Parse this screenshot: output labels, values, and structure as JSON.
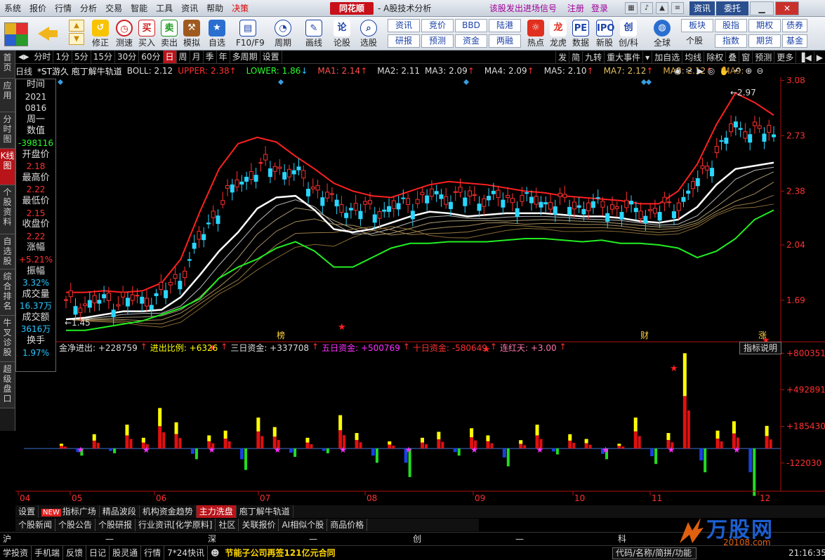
{
  "menubar": {
    "items": [
      "系统",
      "报价",
      "行情",
      "分析",
      "交易",
      "智能",
      "工具",
      "资讯",
      "帮助",
      "决策"
    ],
    "brand": "同花顺",
    "subtitle": "- A股技术分析",
    "promo": "该股发出进场信号",
    "register": "注册",
    "login": "登录",
    "news_btn": "资讯",
    "trade_btn": "委托"
  },
  "toolbar": {
    "buttons": [
      "修正",
      "测速",
      "买入",
      "卖出",
      "模拟",
      "自选",
      "F10/F9",
      "周期",
      "画线",
      "论股",
      "选股",
      "热点",
      "龙虎",
      "数据",
      "新股",
      "创/科",
      "全球",
      "个股"
    ],
    "grid": [
      [
        "资讯",
        "竞价",
        "BBD",
        "陆港"
      ],
      [
        "研报",
        "预测",
        "资金",
        "两融"
      ],
      [
        "板块",
        "股指",
        "期权",
        "债券"
      ],
      [
        "指数",
        "期货",
        "基金"
      ]
    ]
  },
  "leftnav": [
    "首页",
    "应用",
    "分时图",
    "K线图",
    "个股资料",
    "自选股",
    "综合排名",
    "牛叉诊股",
    "超级盘口"
  ],
  "periodbar": {
    "tabs": [
      "分时",
      "1分",
      "5分",
      "15分",
      "30分",
      "60分",
      "日",
      "周",
      "月",
      "季",
      "年",
      "多周期",
      "设置"
    ],
    "active": "日",
    "right": [
      "发",
      "简",
      "九转",
      "重大事件",
      "加自选",
      "均线",
      "除权",
      "叠",
      "窗",
      "预测",
      "更多"
    ]
  },
  "chartheader": {
    "period": "日线",
    "name": "*ST游久  庖丁解牛轨道",
    "boll": "BOLL: 2.12",
    "upper": "UPPER: 2.38",
    "lower": "LOWER: 1.86",
    "ma1": "MA1: 2.14",
    "ma2": "MA2: 2.11",
    "ma3": "MA3: 2.09",
    "ma4": "MA4: 2.09",
    "ma5": "MA5: 2.10",
    "ma7": "MA7: 2.12",
    "ma8": "MA8: 2.12",
    "ma9": "MA9:"
  },
  "datawin": {
    "time_label": "时间",
    "year": "2021",
    "date": "0816",
    "weekday": "周一",
    "value_label": "数值",
    "value": "-398116",
    "open_label": "开盘价",
    "open": "2.18",
    "high_label": "最高价",
    "high": "2.22",
    "low_label": "最低价",
    "low": "2.15",
    "close_label": "收盘价",
    "close": "2.22",
    "chg_label": "涨幅",
    "chg": "+5.21%",
    "amp_label": "振幅",
    "amp": "3.32%",
    "vol_label": "成交量",
    "vol": "16.37万",
    "amt_label": "成交额",
    "amt": "3616万",
    "turn_label": "换手",
    "turn": "1.97%"
  },
  "flowheader": {
    "net": "金净进出: +228759",
    "ratio": "进出比例: +6326",
    "three": "三日资金: +337708",
    "five": "五日资金: +500769",
    "ten": "十日资金: -580649",
    "streak": "连红天: +3.00",
    "explain_btn": "指标说明"
  },
  "chart_data": [
    {
      "type": "candlestick",
      "title": "",
      "y_ticks": [
        "3.08",
        "2.73",
        "2.38",
        "2.04",
        "1.69"
      ],
      "ylim": [
        1.45,
        3.1
      ],
      "x_ticks": [
        "04",
        "05",
        "06",
        "07",
        "08",
        "09",
        "10",
        "11",
        "12"
      ],
      "annotations": {
        "high_label": "2.97",
        "low_label": "1.45",
        "event_labels": [
          "榜",
          "财",
          "涨"
        ]
      },
      "grid": false,
      "series": [
        {
          "name": "UPPER",
          "color": "#ff2020",
          "values": [
            1.74,
            1.74,
            1.75,
            1.74,
            1.75,
            1.8,
            1.95,
            2.25,
            2.52,
            2.68,
            2.72,
            2.69,
            2.6,
            2.52,
            2.43,
            2.38,
            2.35,
            2.34,
            2.38,
            2.42,
            2.44,
            2.43,
            2.42,
            2.4,
            2.38,
            2.37,
            2.35,
            2.34,
            2.33,
            2.32,
            2.3,
            2.3,
            2.38,
            2.55,
            2.8,
            3.0,
            2.94,
            2.86
          ]
        },
        {
          "name": "LOWER",
          "color": "#22ee22",
          "values": [
            1.5,
            1.5,
            1.52,
            1.54,
            1.56,
            1.6,
            1.64,
            1.7,
            1.83,
            1.9,
            1.95,
            2.02,
            2.06,
            2.0,
            1.9,
            1.9,
            1.96,
            2.02,
            2.05,
            2.05,
            2.06,
            2.06,
            2.06,
            2.07,
            2.08,
            2.08,
            2.07,
            2.06,
            2.07,
            2.05,
            2.05,
            2.04,
            2.02,
            1.96,
            2.0,
            2.08,
            2.2,
            2.26
          ]
        },
        {
          "name": "MA1",
          "color": "#ffffff",
          "values": [
            1.57,
            1.58,
            1.6,
            1.62,
            1.62,
            1.63,
            1.71,
            1.85,
            2.0,
            2.12,
            2.27,
            2.34,
            2.35,
            2.26,
            2.14,
            2.12,
            2.14,
            2.18,
            2.22,
            2.25,
            2.24,
            2.22,
            2.23,
            2.24,
            2.24,
            2.24,
            2.23,
            2.22,
            2.22,
            2.21,
            2.19,
            2.18,
            2.2,
            2.28,
            2.42,
            2.52,
            2.54,
            2.56
          ]
        }
      ],
      "candles_ohlc_sample": [
        [
          1.55,
          1.58,
          1.52,
          1.54
        ],
        [
          1.6,
          1.64,
          1.58,
          1.62
        ],
        [
          1.66,
          1.7,
          1.63,
          1.67
        ],
        [
          1.85,
          1.92,
          1.82,
          1.9
        ],
        [
          2.35,
          2.6,
          2.3,
          2.45
        ],
        [
          2.4,
          2.48,
          2.32,
          2.36
        ],
        [
          2.12,
          2.18,
          1.98,
          2.02
        ],
        [
          2.3,
          2.35,
          2.24,
          2.32
        ],
        [
          2.25,
          2.3,
          2.2,
          2.26
        ],
        [
          2.2,
          2.26,
          2.16,
          2.22
        ],
        [
          2.5,
          2.97,
          2.48,
          2.8
        ],
        [
          2.55,
          2.74,
          2.52,
          2.67
        ]
      ]
    },
    {
      "type": "bar",
      "title": "",
      "y_ticks": [
        "+800351",
        "+492891",
        "+185430",
        "-122030"
      ],
      "ylim": [
        -300000,
        820000
      ],
      "values": [
        40000,
        -60000,
        120000,
        -40000,
        200000,
        90000,
        340000,
        220000,
        -90000,
        110000,
        150000,
        -180000,
        260000,
        180000,
        -70000,
        90000,
        -40000,
        280000,
        130000,
        -120000,
        60000,
        -240000,
        90000,
        140000,
        -60000,
        170000,
        110000,
        -150000,
        70000,
        200000,
        -50000,
        120000,
        80000,
        -90000,
        40000,
        260000,
        -130000,
        130000,
        800351,
        -200000,
        150000,
        228759,
        -398116,
        190000
      ]
    }
  ],
  "indtabs": {
    "items": [
      "设置",
      "指标广场",
      "精品波段",
      "机构资金趋势",
      "主力洗盘",
      "庖丁解牛轨道"
    ],
    "new": "NEW",
    "active": "主力洗盘"
  },
  "newsrow": [
    "个股新闻",
    "个股公告",
    "个股研报",
    "行业资讯[化学原料]",
    "社区",
    "关联报价",
    "AI相似个股",
    "商品价格"
  ],
  "marketrow": {
    "sh": "沪",
    "sz": "深",
    "cy": "创",
    "kc": "科",
    "dash": "—"
  },
  "statusbar": {
    "items": [
      "学投资",
      "手机端",
      "反馈",
      "日记",
      "股灵通",
      "行情",
      "7*24快讯"
    ],
    "ticker": "节能子公司再签121亿元合同",
    "code_placeholder": "代码/名称/简拼/功能",
    "clock": "21:16:35"
  },
  "watermark": {
    "title": "万股网",
    "site": "20108.com"
  }
}
